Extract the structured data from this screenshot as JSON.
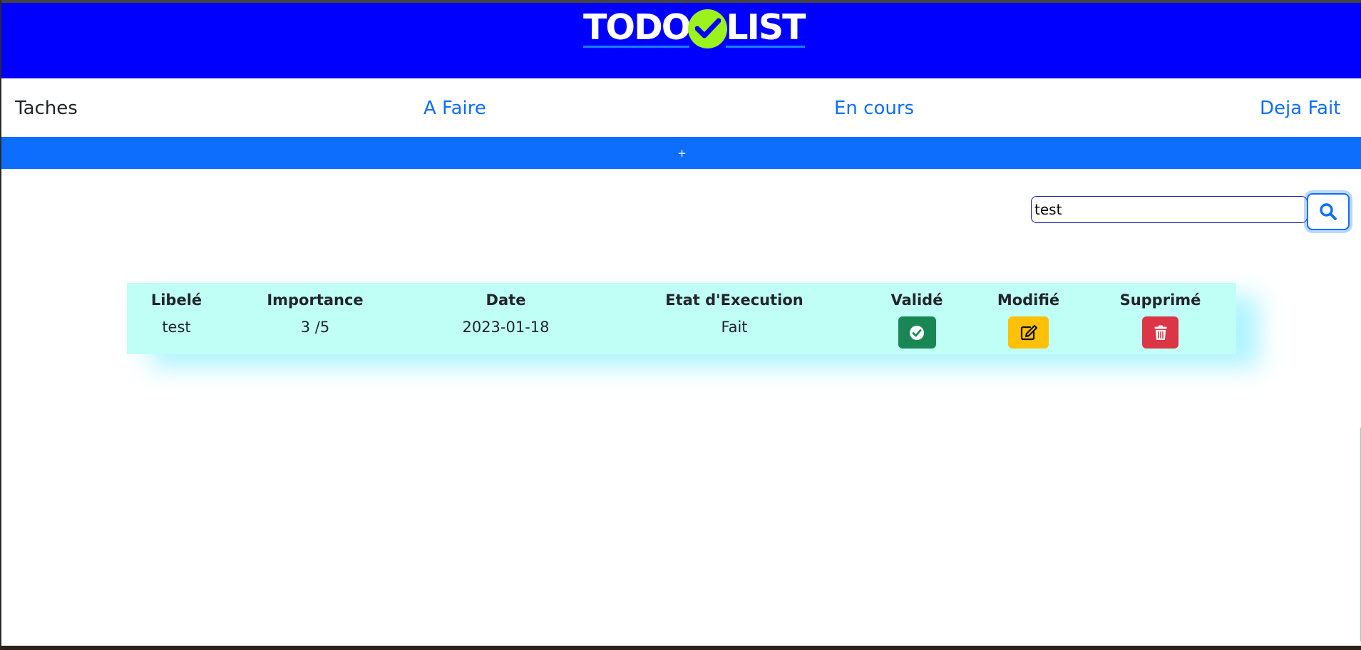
{
  "header": {
    "logo_left": "TODO",
    "logo_right": "LIST",
    "logo_icon": "check-circle-icon",
    "background_color": "#0000ff",
    "logo_check_color": "#9bf21d"
  },
  "nav": {
    "brand": "Taches",
    "links": [
      {
        "label": "A Faire"
      },
      {
        "label": "En cours"
      },
      {
        "label": "Deja Fait"
      }
    ]
  },
  "add_button": {
    "label": "+",
    "color": "#0d6efd"
  },
  "search": {
    "value": "test",
    "icon": "search-icon"
  },
  "table": {
    "background_color": "#c0fff6",
    "headers": [
      "Libelé",
      "Importance",
      "Date",
      "Etat d'Execution",
      "Validé",
      "Modifié",
      "Supprimé"
    ],
    "rows": [
      {
        "libele": "test",
        "importance": "3 /5",
        "date": "2023-01-18",
        "etat": "Fait",
        "valider_icon": "check-circle-icon",
        "modifier_icon": "edit-icon",
        "supprimer_icon": "trash-icon"
      }
    ],
    "button_colors": {
      "valider": "#198754",
      "modifier": "#ffc107",
      "supprimer": "#dc3545"
    }
  }
}
